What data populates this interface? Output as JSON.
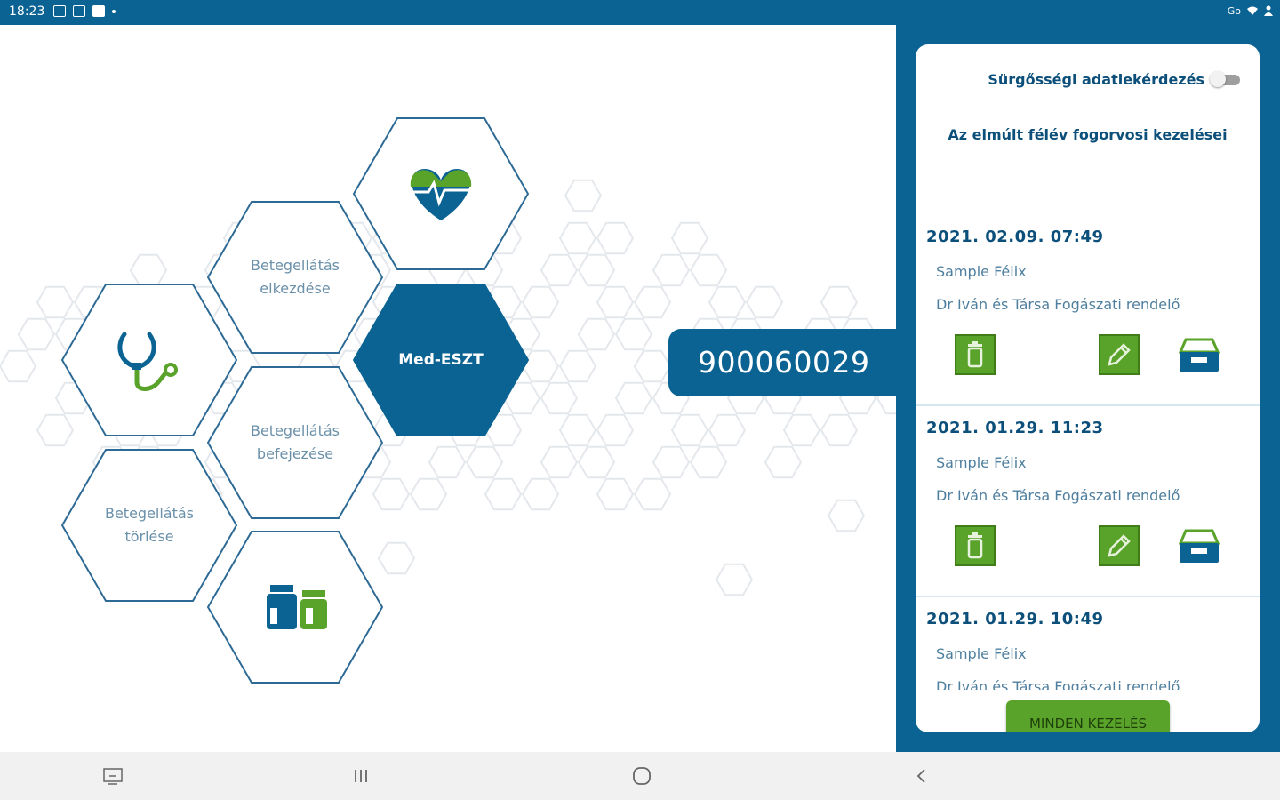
{
  "status_bar": {
    "time": "18:23",
    "network": "Go"
  },
  "hex_menu": {
    "start_label": "Betegellátás elkezdése",
    "finish_label": "Betegellátás befejezése",
    "delete_label": "Betegellátás törlése",
    "brand_label": "Med-ESZT"
  },
  "patient_id": "900060029",
  "sidebar": {
    "emergency_label": "Sürgősségi adatlekérdezés",
    "emergency_on": false,
    "section_title": "Az elmúlt félév fogorvosi kezelései",
    "treatments": [
      {
        "date": "2021. 02.09. 07:49",
        "patient": "Sample Félix",
        "clinic": "Dr Iván és Társa Fogászati rendelő"
      },
      {
        "date": "2021. 01.29. 11:23",
        "patient": "Sample Félix",
        "clinic": "Dr Iván és Társa Fogászati rendelő"
      },
      {
        "date": "2021. 01.29. 10:49",
        "patient": "Sample Félix",
        "clinic": "Dr Iván és Társa Fogászati rendelő"
      }
    ],
    "all_button": "MINDEN KEZELÉS"
  },
  "colors": {
    "primary": "#0b6393",
    "accent": "#5aa32a",
    "hex_outline": "#2d6a96"
  },
  "icons": [
    "heart-pulse-icon",
    "stethoscope-icon",
    "medication-icon",
    "trash-icon",
    "edit-icon",
    "inbox-icon"
  ]
}
